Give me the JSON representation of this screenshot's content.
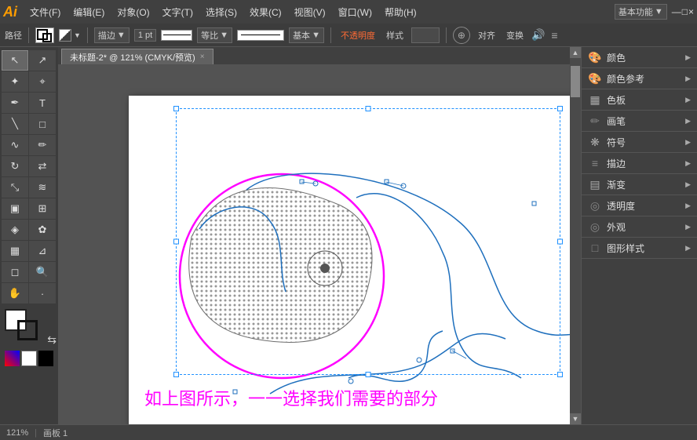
{
  "app": {
    "logo": "Ai",
    "title": "未标题-2* @ 121% (CMYK/预览)",
    "mode": "基本功能"
  },
  "menubar": {
    "items": [
      "文件(F)",
      "编辑(E)",
      "对象(O)",
      "文字(T)",
      "选择(S)",
      "效果(C)",
      "视图(V)",
      "窗口(W)",
      "帮助(H)"
    ]
  },
  "toolbar": {
    "label": "路径",
    "stroke_width": "1 pt",
    "type1": "描边",
    "line_style": "等比",
    "line_base": "基本",
    "opacity_label": "不透明度",
    "style_label": "样式",
    "align_label": "对齐",
    "transform_label": "变换"
  },
  "tab": {
    "title": "未标题-2* @ 121% (CMYK/预览)",
    "close": "×"
  },
  "tools": {
    "left_tools": [
      {
        "name": "select-tool",
        "icon": "↖",
        "active": true
      },
      {
        "name": "direct-select-tool",
        "icon": "↗"
      },
      {
        "name": "magic-wand-tool",
        "icon": "✦"
      },
      {
        "name": "lasso-tool",
        "icon": "⌖"
      },
      {
        "name": "pen-tool",
        "icon": "✒"
      },
      {
        "name": "type-tool",
        "icon": "T"
      },
      {
        "name": "line-tool",
        "icon": "╲"
      },
      {
        "name": "rect-tool",
        "icon": "□"
      },
      {
        "name": "paintbrush-tool",
        "icon": "🖌"
      },
      {
        "name": "pencil-tool",
        "icon": "✏"
      },
      {
        "name": "rotate-tool",
        "icon": "↻"
      },
      {
        "name": "reflect-tool",
        "icon": "⇄"
      },
      {
        "name": "scale-tool",
        "icon": "⤡"
      },
      {
        "name": "warp-tool",
        "icon": "≋"
      },
      {
        "name": "gradient-tool",
        "icon": "▣"
      },
      {
        "name": "mesh-tool",
        "icon": "⊞"
      },
      {
        "name": "blend-tool",
        "icon": "◈"
      },
      {
        "name": "symbol-tool",
        "icon": "✿"
      },
      {
        "name": "chart-tool",
        "icon": "📊"
      },
      {
        "name": "slice-tool",
        "icon": "⊿"
      },
      {
        "name": "eraser-tool",
        "icon": "◻"
      },
      {
        "name": "zoom-tool",
        "icon": "🔍"
      },
      {
        "name": "hand-tool",
        "icon": "✋"
      }
    ]
  },
  "right_panel": {
    "groups": [
      {
        "name": "颜色",
        "icon": "🎨",
        "expanded": false
      },
      {
        "name": "颜色参考",
        "icon": "🎨",
        "expanded": false
      },
      {
        "name": "色板",
        "icon": "▦",
        "expanded": false
      },
      {
        "name": "画笔",
        "icon": "🖌",
        "expanded": false
      },
      {
        "name": "符号",
        "icon": "❋",
        "expanded": false
      },
      {
        "name": "描边",
        "icon": "≡",
        "expanded": false
      },
      {
        "name": "渐变",
        "icon": "▤",
        "expanded": false
      },
      {
        "name": "透明度",
        "icon": "◎",
        "expanded": false
      },
      {
        "name": "外观",
        "icon": "◎",
        "expanded": false
      },
      {
        "name": "图形样式",
        "icon": "□",
        "expanded": false
      }
    ]
  },
  "canvas": {
    "caption": "如上图所示，一一选择我们需要的部分",
    "caption_color": "#ff00ff",
    "zoom": "121%",
    "mode": "CMYK/预览"
  },
  "statusbar": {
    "zoom_level": "121%",
    "artboard": "画板 1"
  },
  "win_buttons": {
    "minimize": "—",
    "maximize": "□",
    "close": "×"
  }
}
